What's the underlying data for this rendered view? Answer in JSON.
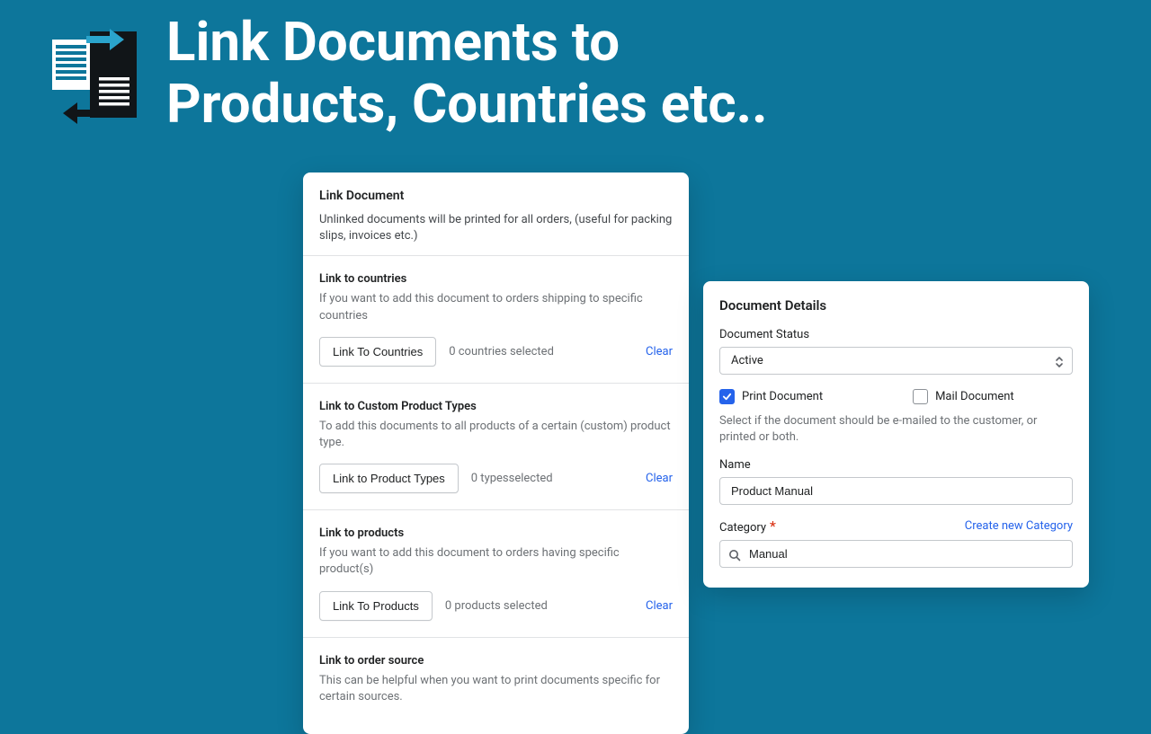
{
  "hero": {
    "title_line1": "Link Documents to",
    "title_line2": "Products, Countries etc.."
  },
  "linkCard": {
    "title": "Link Document",
    "subtext": "Unlinked documents will be printed for all orders, (useful for packing slips, invoices etc.)",
    "sections": {
      "countries": {
        "title": "Link to countries",
        "desc": "If you want to add this document to orders shipping to specific countries",
        "button": "Link To Countries",
        "status": "0 countries selected",
        "clear": "Clear"
      },
      "productTypes": {
        "title": "Link to Custom Product Types",
        "desc": "To add this documents to all products of a certain (custom) product type.",
        "button": "Link to Product Types",
        "status": "0 typesselected",
        "clear": "Clear"
      },
      "products": {
        "title": "Link to products",
        "desc": "If you want to add this document to orders having specific product(s)",
        "button": "Link To Products",
        "status": "0 products selected",
        "clear": "Clear"
      },
      "orderSource": {
        "title": "Link to order source",
        "desc": "This can be helpful when you want to print documents specific for certain sources."
      }
    }
  },
  "detailsCard": {
    "title": "Document Details",
    "status": {
      "label": "Document Status",
      "value": "Active"
    },
    "printLabel": "Print Document",
    "mailLabel": "Mail Document",
    "helper": "Select if the document should be e-mailed to the customer, or printed or both.",
    "name": {
      "label": "Name",
      "value": "Product Manual"
    },
    "category": {
      "label": "Category",
      "createLink": "Create new Category",
      "value": "Manual"
    }
  }
}
